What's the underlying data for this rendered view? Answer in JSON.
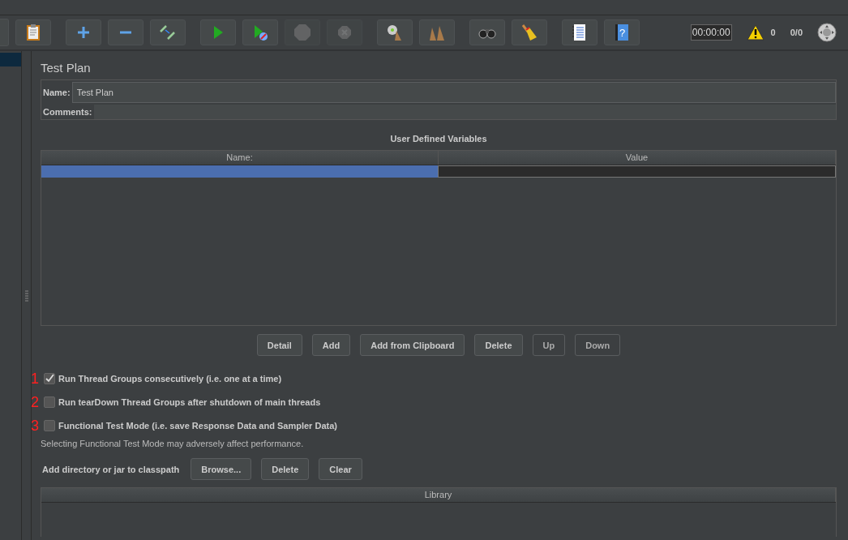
{
  "toolbar": {
    "groups": [
      [
        {
          "kind": "clipboard",
          "disabled": false
        }
      ],
      [
        {
          "kind": "add",
          "disabled": false
        },
        {
          "kind": "remove",
          "disabled": false
        },
        {
          "kind": "toggle",
          "disabled": false
        }
      ],
      [
        {
          "kind": "start",
          "disabled": false
        },
        {
          "kind": "start-no-timers",
          "disabled": false
        },
        {
          "kind": "stop",
          "disabled": true
        },
        {
          "kind": "shutdown",
          "disabled": true
        }
      ],
      [
        {
          "kind": "clear",
          "disabled": false
        },
        {
          "kind": "clear-all",
          "disabled": false
        }
      ],
      [
        {
          "kind": "search",
          "disabled": false
        },
        {
          "kind": "reset",
          "disabled": false
        }
      ],
      [
        {
          "kind": "functions",
          "disabled": false
        },
        {
          "kind": "help",
          "disabled": false,
          "glyph": "?"
        }
      ]
    ],
    "timer": "00:00:00",
    "warning_count": "0",
    "thread_count": "0/0"
  },
  "tree": {
    "items": [
      {
        "selected": true
      }
    ]
  },
  "panel": {
    "title": "Test Plan",
    "name_label": "Name:",
    "name_value": "Test Plan",
    "comments_label": "Comments:"
  },
  "variables": {
    "title": "User Defined Variables",
    "columns": [
      "Name:",
      "Value"
    ],
    "rows": [
      {
        "selected": true
      }
    ]
  },
  "variable_buttons": [
    {
      "label": "Detail",
      "disabled": false
    },
    {
      "label": "Add",
      "disabled": false
    },
    {
      "label": "Add from Clipboard",
      "disabled": false
    },
    {
      "label": "Delete",
      "disabled": false
    },
    {
      "label": "Up",
      "disabled": true
    },
    {
      "label": "Down",
      "disabled": true
    }
  ],
  "options": [
    {
      "marker": "1",
      "label": "Run Thread Groups consecutively (i.e. one at a time)",
      "checked": true
    },
    {
      "marker": "2",
      "label": "Run tearDown Thread Groups after shutdown of main threads",
      "checked": false
    },
    {
      "marker": "3",
      "label": "Functional Test Mode (i.e. save Response Data and Sampler Data)",
      "checked": false
    }
  ],
  "note": "Selecting Functional Test Mode may adversely affect performance.",
  "classpath": {
    "label": "Add directory or jar to classpath",
    "buttons": [
      {
        "label": "Browse...",
        "disabled": false
      },
      {
        "label": "Delete",
        "disabled": false
      },
      {
        "label": "Clear",
        "disabled": false
      }
    ],
    "columns": [
      "Library"
    ]
  }
}
